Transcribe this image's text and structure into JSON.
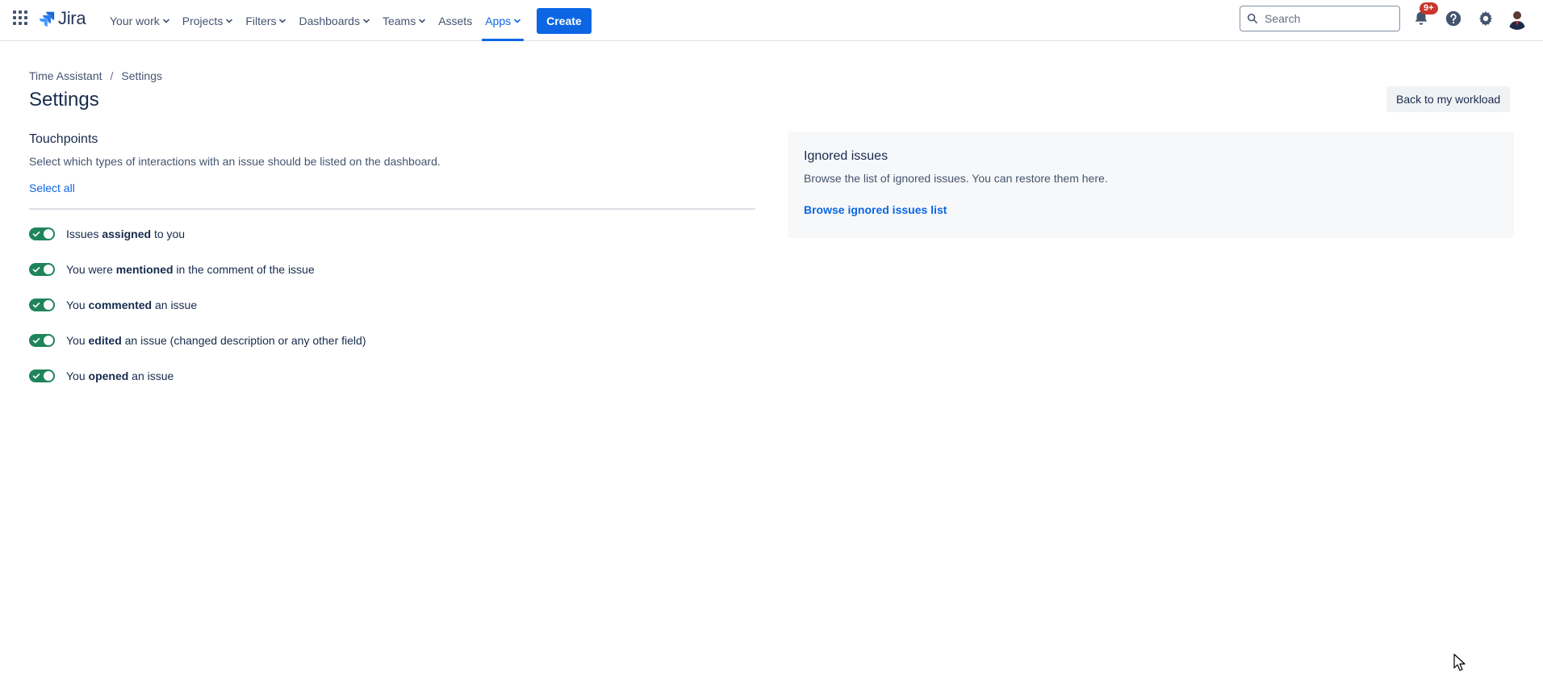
{
  "nav": {
    "logo_text": "Jira",
    "items": [
      {
        "label": "Your work",
        "has_menu": true
      },
      {
        "label": "Projects",
        "has_menu": true
      },
      {
        "label": "Filters",
        "has_menu": true
      },
      {
        "label": "Dashboards",
        "has_menu": true
      },
      {
        "label": "Teams",
        "has_menu": true
      },
      {
        "label": "Assets",
        "has_menu": false
      },
      {
        "label": "Apps",
        "has_menu": true,
        "active": true
      }
    ],
    "create_label": "Create",
    "search_placeholder": "Search",
    "notifications_badge": "9+"
  },
  "colors": {
    "brand_blue": "#0c66e4",
    "toggle_on": "#1f845a",
    "badge_red": "#c9372c",
    "text_primary": "#172b4d",
    "text_subtle": "#44546f"
  },
  "breadcrumb": {
    "items": [
      "Time Assistant",
      "Settings"
    ],
    "separator": "/"
  },
  "page": {
    "title": "Settings",
    "back_button": "Back to my workload"
  },
  "touchpoints": {
    "title": "Touchpoints",
    "description": "Select which types of interactions with an issue should be listed on the dashboard.",
    "select_all": "Select all",
    "toggles": [
      {
        "pre": "Issues ",
        "bold": "assigned",
        "post": " to you",
        "enabled": true
      },
      {
        "pre": "You were ",
        "bold": "mentioned",
        "post": " in the comment of the issue",
        "enabled": true
      },
      {
        "pre": "You ",
        "bold": "commented",
        "post": " an issue",
        "enabled": true
      },
      {
        "pre": "You ",
        "bold": "edited",
        "post": " an issue (changed description or any other field)",
        "enabled": true
      },
      {
        "pre": "You ",
        "bold": "opened",
        "post": " an issue",
        "enabled": true
      }
    ]
  },
  "ignored": {
    "title": "Ignored issues",
    "description": "Browse the list of ignored issues. You can restore them here.",
    "link": "Browse ignored issues list"
  },
  "icons": {
    "app_switcher": "grid-icon",
    "search": "search-icon",
    "notifications": "bell-icon",
    "help": "help-icon",
    "settings": "gear-icon",
    "profile": "avatar",
    "chevron": "chevron-down-icon",
    "toggle_check": "check-icon",
    "cursor": "mouse-pointer-icon"
  }
}
